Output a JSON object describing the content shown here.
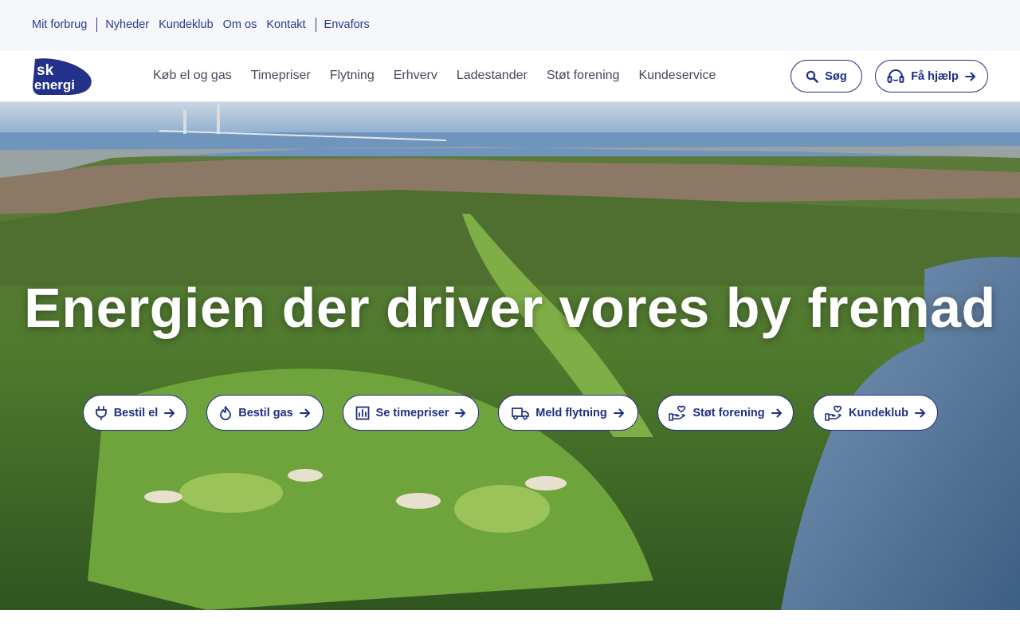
{
  "topbar": {
    "links": [
      "Mit forbrug",
      "Nyheder",
      "Kundeklub",
      "Om os",
      "Kontakt",
      "Envafors"
    ]
  },
  "logo": {
    "line1": "sk",
    "line2": "energi"
  },
  "nav": {
    "items": [
      "Køb el og gas",
      "Timepriser",
      "Flytning",
      "Erhverv",
      "Ladestander",
      "Støt forening",
      "Kundeservice"
    ],
    "search_label": "Søg",
    "help_label": "Få hjælp"
  },
  "hero": {
    "title": "Energien der driver vores by fremad",
    "buttons": [
      "Bestil el",
      "Bestil gas",
      "Se timepriser",
      "Meld flytning",
      "Støt forening",
      "Kundeklub"
    ]
  },
  "colors": {
    "brand": "#1f2f85",
    "topbar_bg": "#f5f7fb"
  }
}
